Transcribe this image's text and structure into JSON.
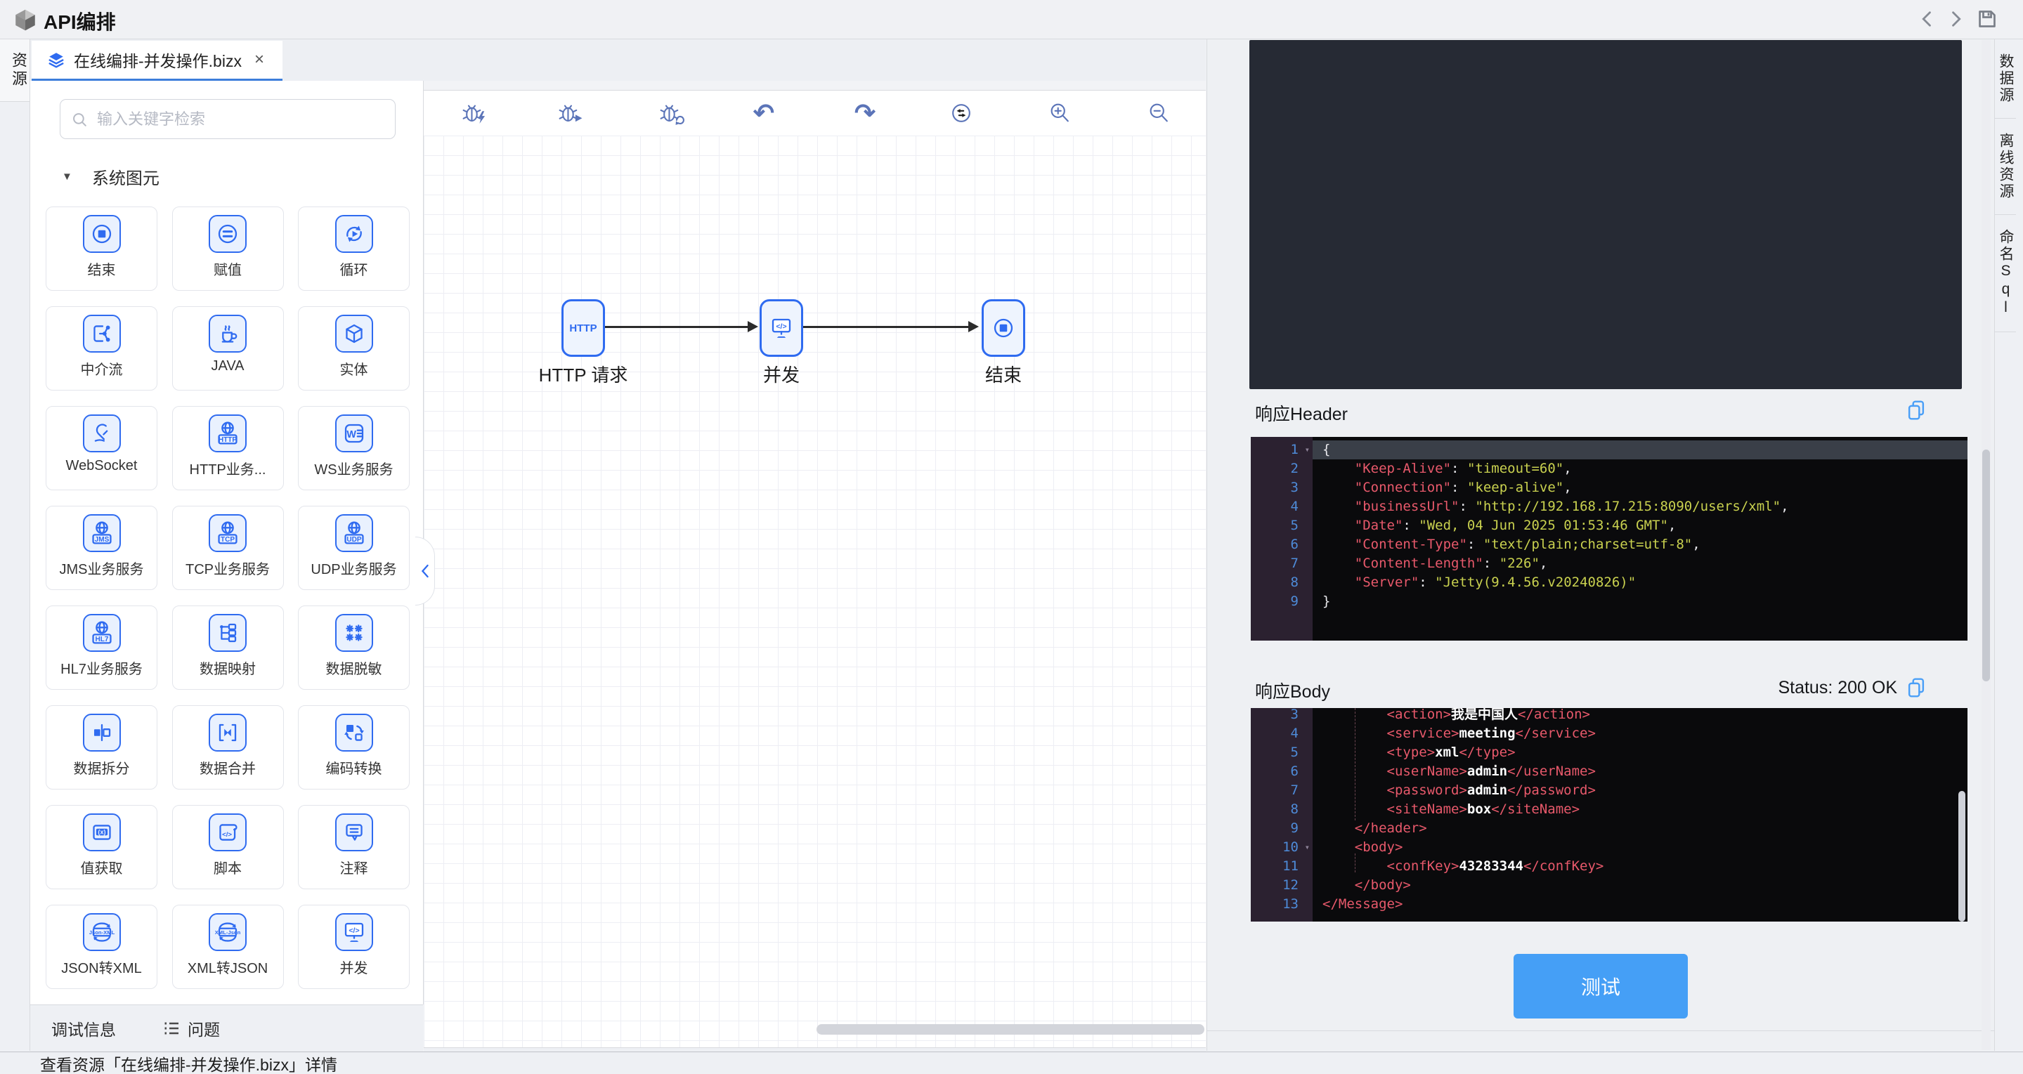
{
  "titlebar": {
    "title": "API编排",
    "icons": [
      "app-logo-cube",
      "chevron-left",
      "chevron-right",
      "save-floppy"
    ]
  },
  "left_strip": {
    "tabs": [
      {
        "label": "资源"
      }
    ]
  },
  "doc_tab": {
    "title": "在线编排-并发操作.bizx",
    "close": "×",
    "icon": "layers-icon"
  },
  "palette": {
    "search_placeholder": "输入关键字检索",
    "search_icon": "search-icon",
    "section_label": "系统图元",
    "section_collapse_icon": "triangle-down-icon",
    "items": [
      {
        "label": "结束",
        "icon": "end"
      },
      {
        "label": "赋值",
        "icon": "assign"
      },
      {
        "label": "循环",
        "icon": "loop"
      },
      {
        "label": "中介流",
        "icon": "mediator"
      },
      {
        "label": "JAVA",
        "icon": "java"
      },
      {
        "label": "实体",
        "icon": "entity"
      },
      {
        "label": "WebSocket",
        "icon": "websocket"
      },
      {
        "label": "HTTP业务...",
        "icon": "http-service"
      },
      {
        "label": "WS业务服务",
        "icon": "ws-service"
      },
      {
        "label": "JMS业务服务",
        "icon": "jms-service"
      },
      {
        "label": "TCP业务服务",
        "icon": "tcp-service"
      },
      {
        "label": "UDP业务服务",
        "icon": "udp-service"
      },
      {
        "label": "HL7业务服务",
        "icon": "hl7-service"
      },
      {
        "label": "数据映射",
        "icon": "data-map"
      },
      {
        "label": "数据脱敏",
        "icon": "data-mask"
      },
      {
        "label": "数据拆分",
        "icon": "data-split"
      },
      {
        "label": "数据合并",
        "icon": "data-merge"
      },
      {
        "label": "编码转换",
        "icon": "encode-convert"
      },
      {
        "label": "值获取",
        "icon": "value-get"
      },
      {
        "label": "脚本",
        "icon": "script"
      },
      {
        "label": "注释",
        "icon": "comment"
      },
      {
        "label": "JSON转XML",
        "icon": "json-to-xml"
      },
      {
        "label": "XML转JSON",
        "icon": "xml-to-json"
      },
      {
        "label": "并发",
        "icon": "concurrent"
      }
    ],
    "collapse_icon": "chevron-left-icon"
  },
  "canvas_toolbar": {
    "icons": [
      "debug-flash",
      "debug-run",
      "debug-step",
      "undo",
      "redo",
      "swap-horizontal",
      "zoom-in",
      "zoom-out"
    ]
  },
  "flow": {
    "nodes": [
      {
        "label": "HTTP 请求",
        "icon": "http-node"
      },
      {
        "label": "并发",
        "icon": "concurrent"
      },
      {
        "label": "结束",
        "icon": "end"
      }
    ]
  },
  "response_header": {
    "title": "响应Header",
    "copy_icon": "copy-icon",
    "lines": [
      {
        "n": 1,
        "fold": true,
        "active": true,
        "seg": [
          [
            "p",
            "{"
          ]
        ]
      },
      {
        "n": 2,
        "seg": [
          [
            "p",
            "    "
          ],
          [
            "k",
            "\"Keep-Alive\""
          ],
          [
            "p",
            ": "
          ],
          [
            "v",
            "\"timeout=60\""
          ],
          [
            "p",
            ","
          ]
        ]
      },
      {
        "n": 3,
        "seg": [
          [
            "p",
            "    "
          ],
          [
            "k",
            "\"Connection\""
          ],
          [
            "p",
            ": "
          ],
          [
            "v",
            "\"keep-alive\""
          ],
          [
            "p",
            ","
          ]
        ]
      },
      {
        "n": 4,
        "seg": [
          [
            "p",
            "    "
          ],
          [
            "k",
            "\"businessUrl\""
          ],
          [
            "p",
            ": "
          ],
          [
            "v",
            "\"http://192.168.17.215:8090/users/xml\""
          ],
          [
            "p",
            ","
          ]
        ]
      },
      {
        "n": 5,
        "seg": [
          [
            "p",
            "    "
          ],
          [
            "k",
            "\"Date\""
          ],
          [
            "p",
            ": "
          ],
          [
            "v",
            "\"Wed, 04 Jun 2025 01:53:46 GMT\""
          ],
          [
            "p",
            ","
          ]
        ]
      },
      {
        "n": 6,
        "seg": [
          [
            "p",
            "    "
          ],
          [
            "k",
            "\"Content-Type\""
          ],
          [
            "p",
            ": "
          ],
          [
            "v",
            "\"text/plain;charset=utf-8\""
          ],
          [
            "p",
            ","
          ]
        ]
      },
      {
        "n": 7,
        "seg": [
          [
            "p",
            "    "
          ],
          [
            "k",
            "\"Content-Length\""
          ],
          [
            "p",
            ": "
          ],
          [
            "v",
            "\"226\""
          ],
          [
            "p",
            ","
          ]
        ]
      },
      {
        "n": 8,
        "seg": [
          [
            "p",
            "    "
          ],
          [
            "k",
            "\"Server\""
          ],
          [
            "p",
            ": "
          ],
          [
            "v",
            "\"Jetty(9.4.56.v20240826)\""
          ]
        ]
      },
      {
        "n": 9,
        "seg": [
          [
            "p",
            "}"
          ]
        ]
      }
    ]
  },
  "response_body": {
    "title": "响应Body",
    "status": "Status: 200 OK",
    "copy_icon": "copy-icon",
    "lines": [
      {
        "n": 3,
        "seg": [
          [
            "p",
            "        "
          ],
          [
            "t",
            "<action>"
          ],
          [
            "x",
            "我是中国人"
          ],
          [
            "t",
            "</action>"
          ]
        ]
      },
      {
        "n": 4,
        "seg": [
          [
            "p",
            "        "
          ],
          [
            "t",
            "<service>"
          ],
          [
            "x",
            "meeting"
          ],
          [
            "t",
            "</service>"
          ]
        ]
      },
      {
        "n": 5,
        "seg": [
          [
            "p",
            "        "
          ],
          [
            "t",
            "<type>"
          ],
          [
            "x",
            "xml"
          ],
          [
            "t",
            "</type>"
          ]
        ]
      },
      {
        "n": 6,
        "seg": [
          [
            "p",
            "        "
          ],
          [
            "t",
            "<userName>"
          ],
          [
            "x",
            "admin"
          ],
          [
            "t",
            "</userName>"
          ]
        ]
      },
      {
        "n": 7,
        "seg": [
          [
            "p",
            "        "
          ],
          [
            "t",
            "<password>"
          ],
          [
            "x",
            "admin"
          ],
          [
            "t",
            "</password>"
          ]
        ]
      },
      {
        "n": 8,
        "seg": [
          [
            "p",
            "        "
          ],
          [
            "t",
            "<siteName>"
          ],
          [
            "x",
            "box"
          ],
          [
            "t",
            "</siteName>"
          ]
        ]
      },
      {
        "n": 9,
        "seg": [
          [
            "p",
            "    "
          ],
          [
            "t",
            "</header>"
          ]
        ]
      },
      {
        "n": 10,
        "fold": true,
        "seg": [
          [
            "p",
            "    "
          ],
          [
            "t",
            "<body>"
          ]
        ]
      },
      {
        "n": 11,
        "seg": [
          [
            "p",
            "        "
          ],
          [
            "t",
            "<confKey>"
          ],
          [
            "x",
            "43283344"
          ],
          [
            "t",
            "</confKey>"
          ]
        ]
      },
      {
        "n": 12,
        "seg": [
          [
            "p",
            "    "
          ],
          [
            "t",
            "</body>"
          ]
        ]
      },
      {
        "n": 13,
        "seg": [
          [
            "t",
            "</Message>"
          ]
        ]
      }
    ]
  },
  "test_button_label": "测试",
  "right_tabs": [
    {
      "label": "数据源"
    },
    {
      "label": "离线资源"
    },
    {
      "label": "命名Sql"
    }
  ],
  "bottom_bar": {
    "debug_label": "调试信息",
    "problems_label": "问题",
    "problems_icon": "list-icon"
  },
  "status_bar": {
    "text": "查看资源「在线编排-并发操作.bizx」详情"
  },
  "colors": {
    "accent": "#2f6bf0",
    "tab_underline": "#3d7edb",
    "test_button": "#459ff6",
    "code_key": "#e8596b",
    "code_value": "#c9d14f",
    "code_tag": "#e8596b",
    "editor_bg": "#0a0a0c",
    "gutter_bg": "#2b2130",
    "dark_panel": "#262a34"
  }
}
